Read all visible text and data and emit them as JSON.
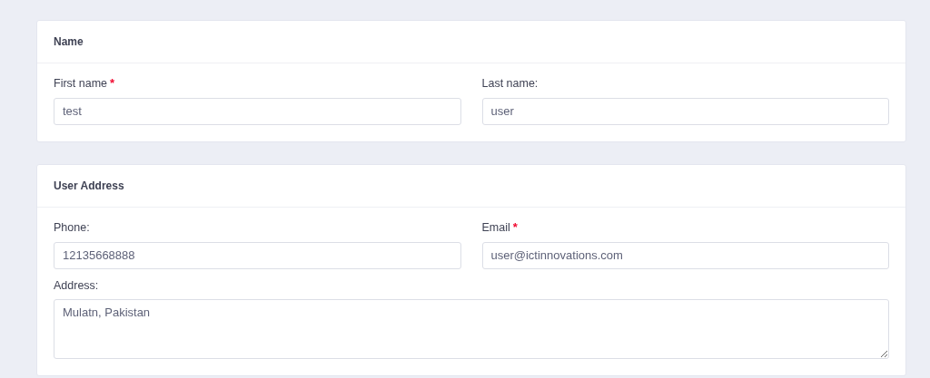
{
  "sections": [
    {
      "title": "Name",
      "fields": [
        {
          "kind": "input",
          "label": "First name",
          "required_mark": "*",
          "value": "test"
        },
        {
          "kind": "input",
          "label": "Last name:",
          "value": "user"
        }
      ]
    },
    {
      "title": "User Address",
      "fields": [
        {
          "kind": "input",
          "label": "Phone:",
          "value": "12135668888"
        },
        {
          "kind": "input",
          "label": "Email",
          "required_mark": "*",
          "value": "user@ictinnovations.com"
        },
        {
          "kind": "textarea",
          "label": "Address:",
          "value": "Mulatn, Pakistan"
        }
      ]
    }
  ]
}
